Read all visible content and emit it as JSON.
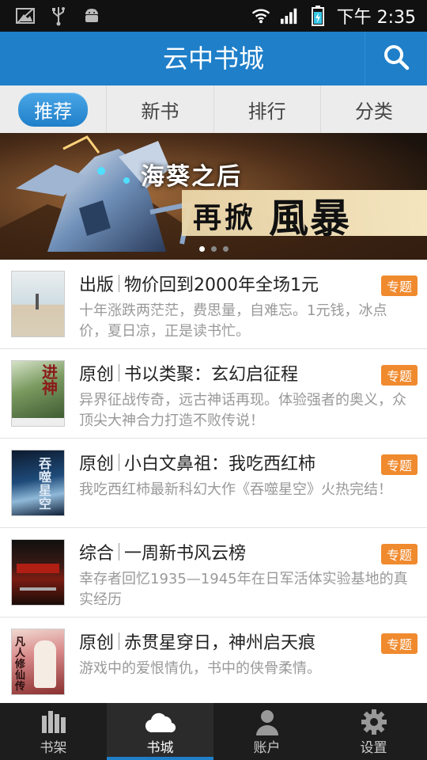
{
  "status_bar": {
    "time": "下午 2:35",
    "icons": [
      "image-icon",
      "usb-icon",
      "android-icon",
      "wifi-icon",
      "signal-icon",
      "battery-icon"
    ]
  },
  "header": {
    "title": "云中书城",
    "search_icon": "search-icon"
  },
  "tabs": [
    {
      "label": "推荐",
      "active": true
    },
    {
      "label": "新书",
      "active": false
    },
    {
      "label": "排行",
      "active": false
    },
    {
      "label": "分类",
      "active": false
    }
  ],
  "banner": {
    "line1": "海葵之后",
    "line2": "再掀",
    "line3": "風暴",
    "page_index": 1,
    "page_count": 3
  },
  "list": [
    {
      "category": "出版",
      "title": "物价回到2000年全场1元",
      "desc": "十年涨跌两茫茫，费思量，自难忘。1元钱，冰点价，夏日凉，正是读书忙。",
      "tag": "专题",
      "cover_color": "#c9dbe0"
    },
    {
      "category": "原创",
      "title": "书以类聚：玄幻启征程",
      "desc": "异界征战传奇，远古神话再现。体验强者的奥义，众顶尖大神合力打造不败传说！",
      "tag": "专题",
      "cover_color": "#6f8f54"
    },
    {
      "category": "原创",
      "title": "小白文鼻祖：我吃西红柿",
      "desc": "我吃西红柿最新科幻大作《吞噬星空》火热完结！",
      "tag": "专题",
      "cover_color": "#2b4d78"
    },
    {
      "category": "综合",
      "title": "一周新书风云榜",
      "desc": "幸存者回忆1935—1945年在日军活体实验基地的真实经历",
      "tag": "专题",
      "cover_color": "#3a1a14"
    },
    {
      "category": "原创",
      "title": "赤贯星穿日，神州启天痕",
      "desc": "游戏中的爱恨情仇，书中的侠骨柔情。",
      "tag": "专题",
      "cover_color": "#d98a8a"
    }
  ],
  "bottom_nav": [
    {
      "label": "书架",
      "icon": "bookshelf-icon",
      "active": false
    },
    {
      "label": "书城",
      "icon": "cloud-icon",
      "active": true
    },
    {
      "label": "账户",
      "icon": "user-icon",
      "active": false
    },
    {
      "label": "设置",
      "icon": "gear-icon",
      "active": false
    }
  ],
  "colors": {
    "accent": "#1f7fc9",
    "tag": "#f08a2e",
    "nav_bg": "#1d1d1d"
  }
}
